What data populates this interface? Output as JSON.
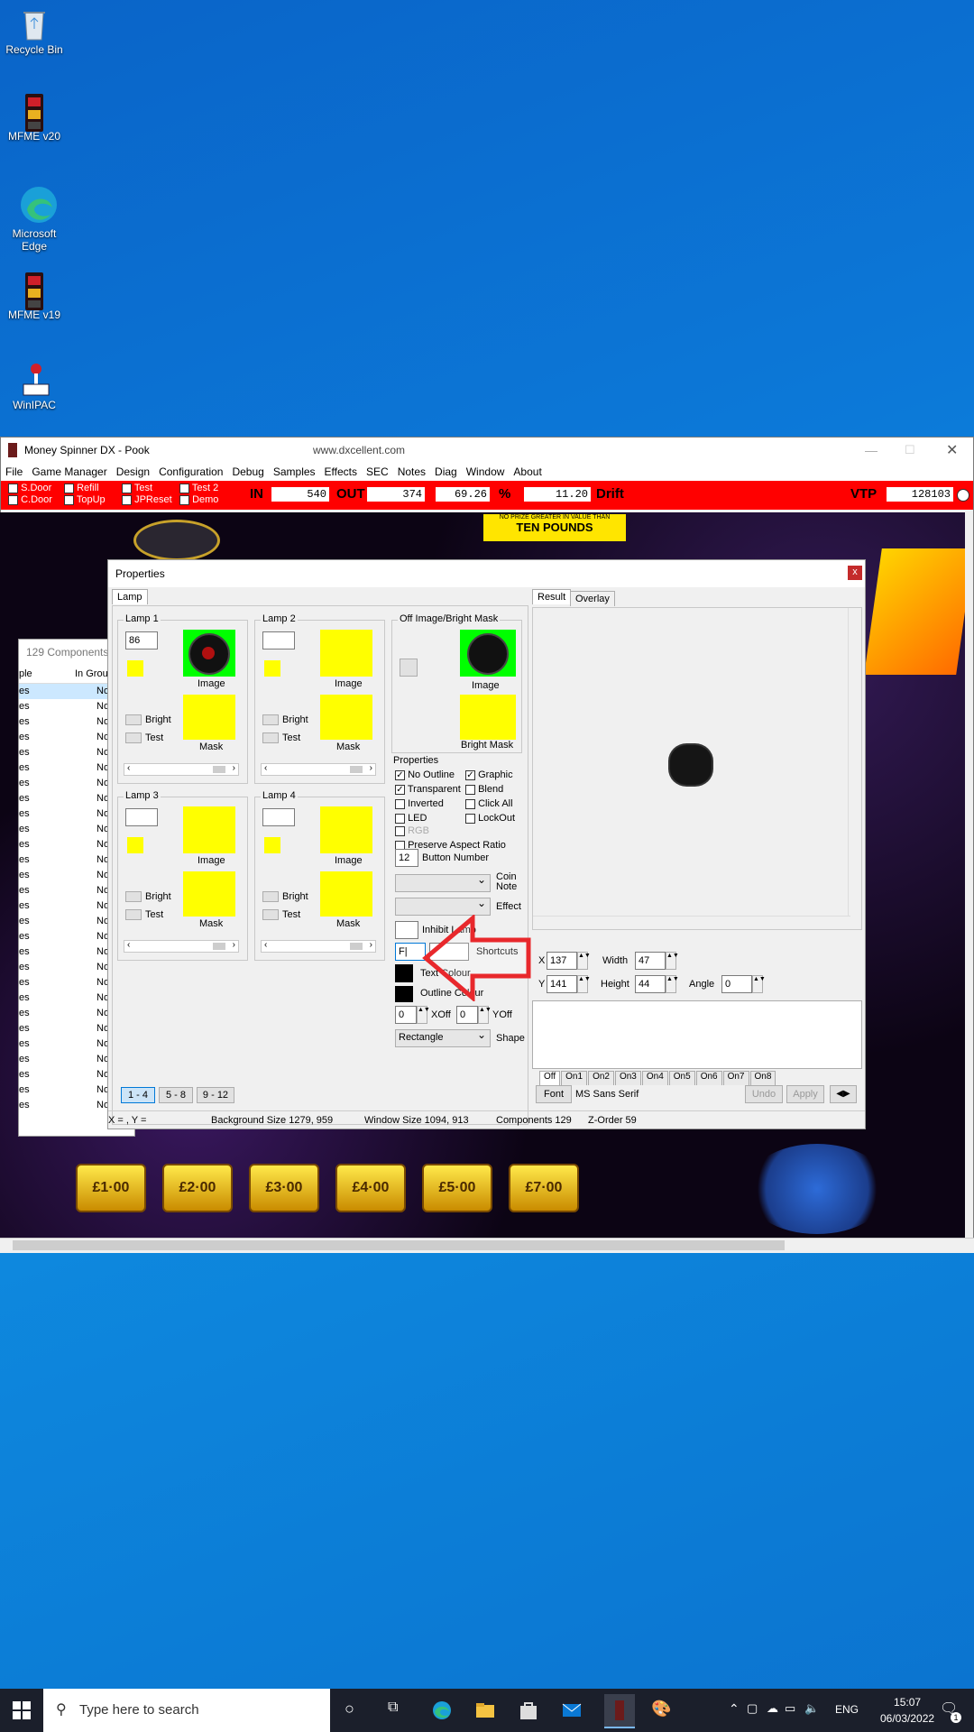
{
  "desktop": {
    "icons": [
      {
        "label": "Recycle Bin"
      },
      {
        "label": "MFME v20"
      },
      {
        "label": "Microsoft Edge"
      },
      {
        "label": "MFME v19"
      },
      {
        "label": "WinIPAC"
      }
    ]
  },
  "window": {
    "title": "Money Spinner DX - Pook",
    "url": "www.dxcellent.com",
    "menu": [
      "File",
      "Game Manager",
      "Design",
      "Configuration",
      "Debug",
      "Samples",
      "Effects",
      "SEC",
      "Notes",
      "Diag",
      "Window",
      "About"
    ]
  },
  "redbar": {
    "checks": [
      "S.Door",
      "C.Door",
      "Refill",
      "TopUp",
      "Test",
      "JPReset",
      "Test 2",
      "Demo"
    ],
    "in_label": "IN",
    "in_value": "540",
    "out_label": "OUT",
    "out_value": "374",
    "pct_value": "69.26",
    "pct_label": "%",
    "drift_value": "11.20",
    "drift_label": "Drift",
    "vtp_label": "VTP",
    "vtp_value": "128103"
  },
  "game": {
    "banner_line1": "NO PRIZE GREATER IN VALUE THAN",
    "banner_line2": "TEN POUNDS",
    "prizes": [
      "£1·00",
      "£2·00",
      "£3·00",
      "£4·00",
      "£5·00",
      "£7·00"
    ]
  },
  "components": {
    "title": "129 Components",
    "col1": "ple",
    "col2": "In Group",
    "row_left": "es",
    "row_right": "No"
  },
  "props": {
    "title": "Properties",
    "close": "x",
    "tab_lamp": "Lamp",
    "lamps": [
      {
        "caption": "Lamp 1",
        "value": "86",
        "image": "Image",
        "mask": "Mask",
        "bright": "Bright",
        "test": "Test"
      },
      {
        "caption": "Lamp 2",
        "value": "",
        "image": "Image",
        "mask": "Mask",
        "bright": "Bright",
        "test": "Test"
      },
      {
        "caption": "Lamp 3",
        "value": "",
        "image": "Image",
        "mask": "Mask",
        "bright": "Bright",
        "test": "Test"
      },
      {
        "caption": "Lamp 4",
        "value": "",
        "image": "Image",
        "mask": "Mask",
        "bright": "Bright",
        "test": "Test"
      }
    ],
    "offimage": {
      "caption": "Off Image/Bright Mask",
      "image": "Image",
      "bright_mask": "Bright Mask"
    },
    "properties_caption": "Properties",
    "checks": [
      {
        "label": "No Outline",
        "checked": true
      },
      {
        "label": "Graphic",
        "checked": true
      },
      {
        "label": "Transparent",
        "checked": true
      },
      {
        "label": "Blend",
        "checked": false
      },
      {
        "label": "Inverted",
        "checked": false
      },
      {
        "label": "Click All",
        "checked": false
      },
      {
        "label": "LED",
        "checked": false
      },
      {
        "label": "LockOut",
        "checked": false
      },
      {
        "label": "RGB",
        "checked": false
      },
      {
        "label": "Preserve Aspect Ratio",
        "checked": false
      }
    ],
    "button_number": "12",
    "button_number_label": "Button Number",
    "coin_note": "Coin Note",
    "effect": "Effect",
    "inhibit_lamp": "Inhibit Lamp",
    "shortcut_value": "F|",
    "shortcuts": "Shortcuts",
    "text_colour": "Text Colour",
    "outline_colour": "Outline Colour",
    "xoff_value": "0",
    "xoff": "XOff",
    "yoff_value": "0",
    "yoff": "YOff",
    "shape_value": "Rectangle",
    "shape": "Shape",
    "pages": [
      "1 - 4",
      "5 - 8",
      "9 - 12"
    ],
    "result_tab": "Result",
    "overlay_tab": "Overlay",
    "x_label": "X",
    "x_value": "137",
    "y_label": "Y",
    "y_value": "141",
    "width_label": "Width",
    "width_value": "47",
    "height_label": "Height",
    "height_value": "44",
    "angle_label": "Angle",
    "angle_value": "0",
    "state_tabs": [
      "Off",
      "On1",
      "On2",
      "On3",
      "On4",
      "On5",
      "On6",
      "On7",
      "On8"
    ],
    "font_button": "Font",
    "font_name": "MS Sans Serif",
    "undo": "Undo",
    "apply": "Apply",
    "status": {
      "xy": "X = , Y =",
      "bg": "Background Size 1279, 959",
      "win": "Window Size 1094, 913",
      "comp": "Components 129",
      "z": "Z-Order 59"
    }
  },
  "taskbar": {
    "search_placeholder": "Type here to search",
    "lang": "ENG",
    "time": "15:07",
    "date": "06/03/2022",
    "notif": "1"
  },
  "colors": {
    "accent_red": "#ff0000",
    "lamp_yellow": "#ffff00",
    "arrow_red": "#e8282c"
  }
}
